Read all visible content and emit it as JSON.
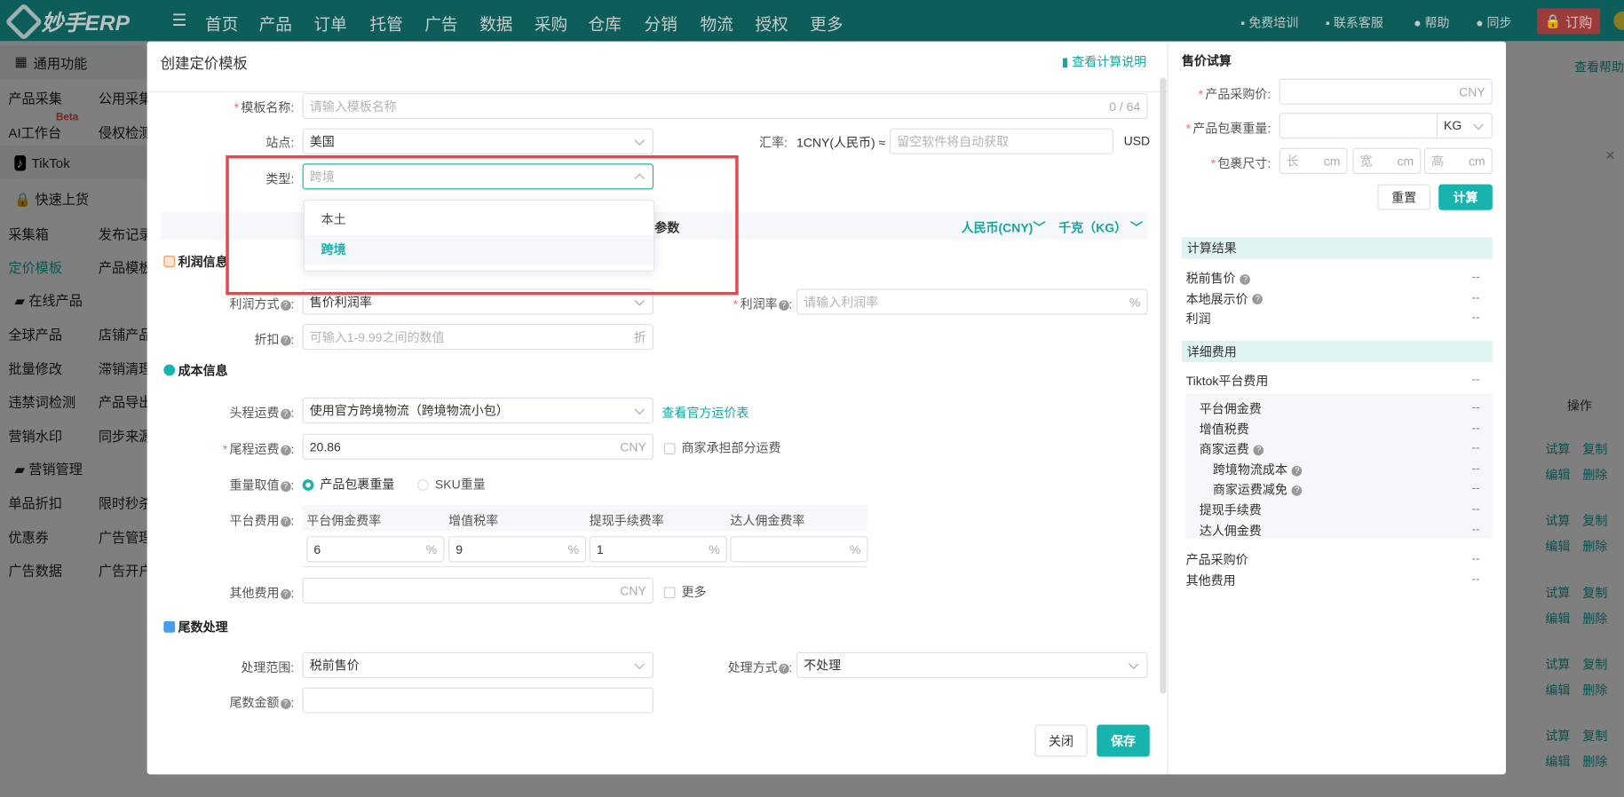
{
  "topbar": {
    "logo": "妙手ERP",
    "nav": [
      {
        "label": "首页",
        "dot": false
      },
      {
        "label": "产品",
        "dot": false
      },
      {
        "label": "订单",
        "dot": true
      },
      {
        "label": "托管",
        "dot": true
      },
      {
        "label": "广告",
        "dot": false
      },
      {
        "label": "数据",
        "dot": false
      },
      {
        "label": "采购",
        "dot": true
      },
      {
        "label": "仓库",
        "dot": true
      },
      {
        "label": "分销",
        "dot": false
      },
      {
        "label": "物流",
        "dot": false
      },
      {
        "label": "授权",
        "dot": false
      },
      {
        "label": "更多",
        "dot": false
      }
    ],
    "right": {
      "training": "免费培训",
      "support": "联系客服",
      "help": "帮助",
      "sync": "同步",
      "buy": "订购"
    }
  },
  "sidebar": {
    "sections": {
      "general": "通用功能",
      "tiktok": "TikTok",
      "quick": "快速上货",
      "online": "在线产品",
      "marketing": "营销管理"
    },
    "rows": [
      [
        "产品采集",
        "公用采集"
      ],
      [
        "AI工作台",
        "侵权检测"
      ],
      [
        "采集箱",
        "发布记录"
      ],
      [
        "定价模板",
        "产品模板"
      ],
      [
        "全球产品",
        "店铺产品"
      ],
      [
        "批量修改",
        "滞销清理"
      ],
      [
        "违禁词检测",
        "产品导出"
      ],
      [
        "营销水印",
        "同步来源"
      ],
      [
        "单品折扣",
        "限时秒杀"
      ],
      [
        "优惠券",
        "广告管理"
      ],
      [
        "广告数据",
        "广告开户"
      ]
    ],
    "beta": "Beta",
    "active": "定价模板"
  },
  "background": {
    "help_link": "查看帮助",
    "ops_header": "操作",
    "row_actions": [
      "试算",
      "复制",
      "编辑",
      "删除"
    ]
  },
  "modal": {
    "title": "创建定价模板",
    "calc_doc_link": "查看计算说明",
    "template_name": {
      "label": "模板名称:",
      "placeholder": "请输入模板名称",
      "counter": "0 / 64"
    },
    "site": {
      "label": "站点:",
      "value": "美国"
    },
    "rate": {
      "label": "汇率:",
      "prefix": "1CNY(人民币) ≈",
      "placeholder": "留空软件将自动获取",
      "unit": "USD"
    },
    "type": {
      "label": "类型:",
      "value": "跨境",
      "options": [
        "本土",
        "跨境"
      ],
      "selected": "跨境"
    },
    "param_band": {
      "text": "参数",
      "currency": "人民币(CNY)",
      "weight": "千克（KG）"
    },
    "profit": {
      "title": "利润信息",
      "method_label": "利润方式",
      "method_value": "售价利润率",
      "rate_label": "利润率",
      "rate_placeholder": "请输入利润率",
      "rate_unit": "%",
      "discount_label": "折扣",
      "discount_placeholder": "可输入1-9.99之间的数值",
      "discount_unit": "折"
    },
    "cost": {
      "title": "成本信息",
      "first_leg_label": "头程运费",
      "first_leg_value": "使用官方跨境物流（跨境物流小包）",
      "rate_table_link": "查看官方运价表",
      "last_leg_label": "尾程运费",
      "last_leg_value": "20.86",
      "last_leg_unit": "CNY",
      "merchant_share": "商家承担部分运费",
      "weight_label": "重量取值",
      "weight_options": [
        "产品包裹重量",
        "SKU重量"
      ],
      "weight_selected": "产品包裹重量",
      "platform_label": "平台费用",
      "platform_fees": [
        {
          "name": "平台佣金费率",
          "value": "6"
        },
        {
          "name": "增值税率",
          "value": "9"
        },
        {
          "name": "提现手续费率",
          "value": "1"
        },
        {
          "name": "达人佣金费率",
          "value": ""
        }
      ],
      "percent": "%",
      "other_label": "其他费用",
      "other_unit": "CNY",
      "more": "更多"
    },
    "rounding": {
      "title": "尾数处理",
      "scope_label": "处理范围:",
      "scope_value": "税前售价",
      "method_label": "处理方式",
      "method_value": "不处理",
      "amount_label": "尾数金额"
    },
    "close": "关闭",
    "save": "保存"
  },
  "calculator": {
    "title": "售价试算",
    "purchase_label": "产品采购价:",
    "purchase_unit": "CNY",
    "weight_label": "产品包裹重量:",
    "weight_unit": "KG",
    "size_label": "包裹尺寸:",
    "size_fields": [
      {
        "ph": "长",
        "unit": "cm"
      },
      {
        "ph": "宽",
        "unit": "cm"
      },
      {
        "ph": "高",
        "unit": "cm"
      }
    ],
    "reset": "重置",
    "calc": "计算",
    "results_title": "计算结果",
    "results": [
      {
        "label": "税前售价",
        "help": true,
        "value": "--"
      },
      {
        "label": "本地展示价",
        "help": true,
        "value": "--"
      },
      {
        "label": "利润",
        "help": false,
        "value": "--"
      }
    ],
    "details_title": "详细费用",
    "platform_total": {
      "label": "Tiktok平台费用",
      "value": "--"
    },
    "platform_items": [
      {
        "label": "平台佣金费",
        "help": false,
        "indent": 1,
        "value": "--"
      },
      {
        "label": "增值税费",
        "help": false,
        "indent": 1,
        "value": "--"
      },
      {
        "label": "商家运费",
        "help": true,
        "indent": 1,
        "value": "--"
      },
      {
        "label": "跨境物流成本",
        "help": true,
        "indent": 2,
        "value": "--"
      },
      {
        "label": "商家运费减免",
        "help": true,
        "indent": 2,
        "value": "--"
      },
      {
        "label": "提现手续费",
        "help": false,
        "indent": 1,
        "value": "--"
      },
      {
        "label": "达人佣金费",
        "help": false,
        "indent": 1,
        "value": "--"
      }
    ],
    "tail": [
      {
        "label": "产品采购价",
        "value": "--"
      },
      {
        "label": "其他费用",
        "value": "--"
      }
    ]
  },
  "colors": {
    "accent": "#17b3ad",
    "highlight_box": "#e5484d",
    "topbar": "#0d5d5a"
  }
}
